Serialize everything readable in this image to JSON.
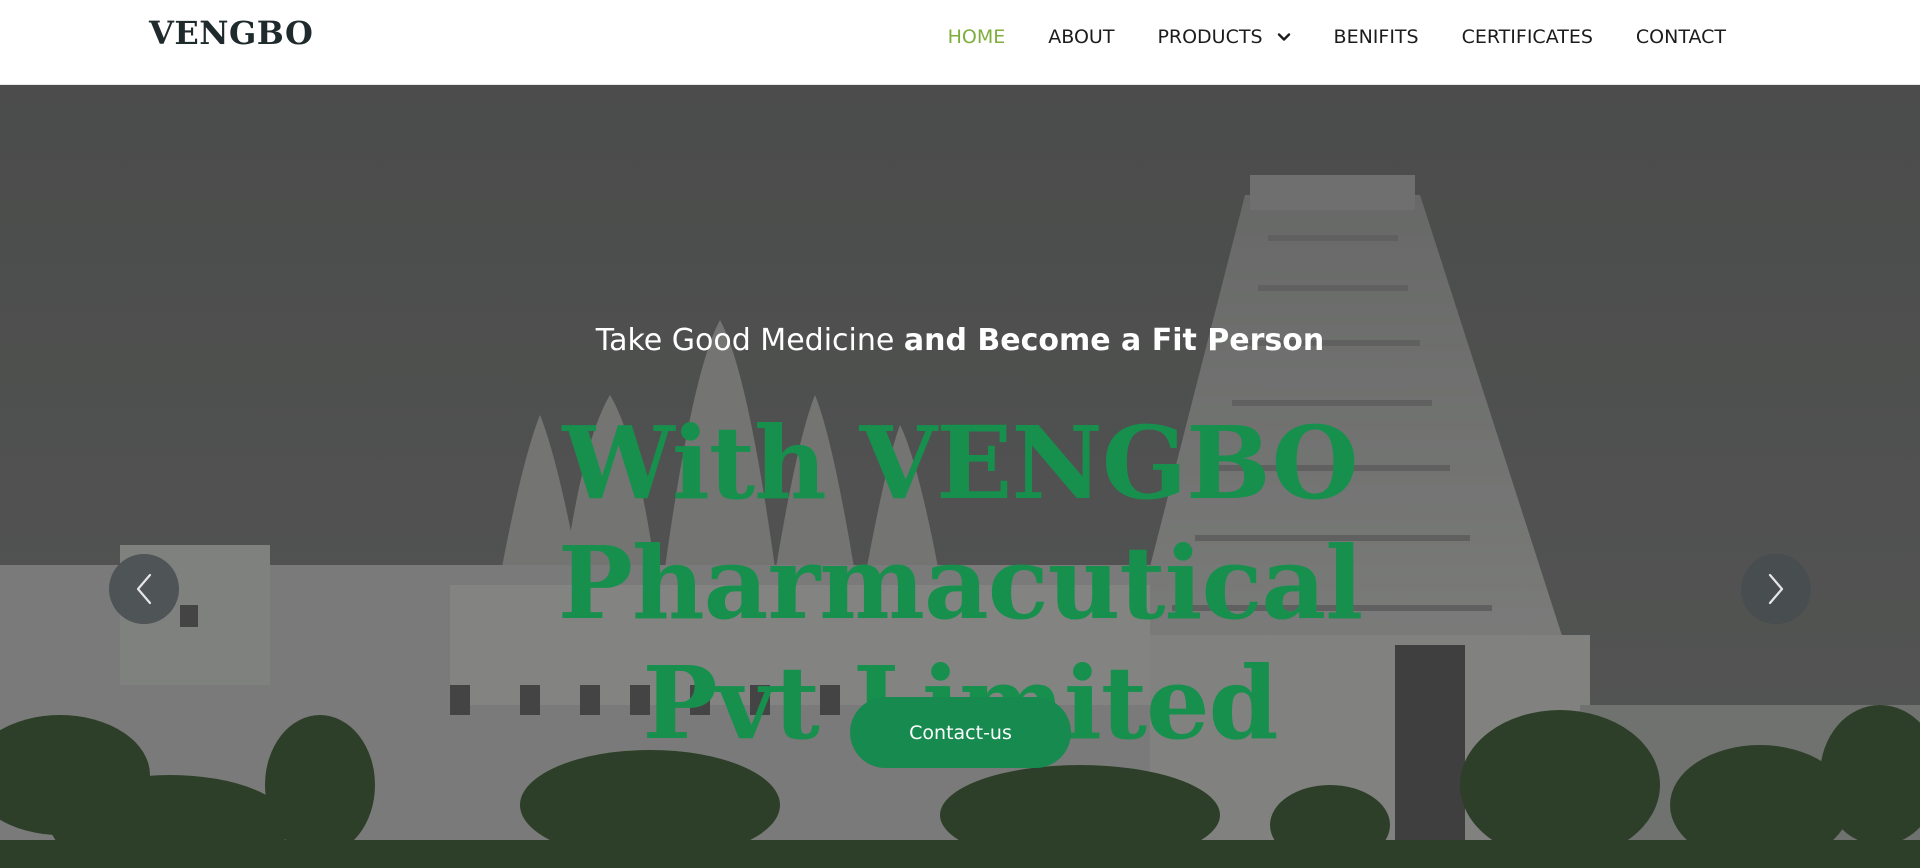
{
  "header": {
    "logo": "VENGBO",
    "nav": [
      {
        "label": "HOME",
        "active": true
      },
      {
        "label": "ABOUT",
        "active": false
      },
      {
        "label": "PRODUCTS",
        "active": false,
        "has_dropdown": true
      },
      {
        "label": "BENIFITS",
        "active": false
      },
      {
        "label": "CERTIFICATES",
        "active": false
      },
      {
        "label": "CONTACT",
        "active": false
      }
    ],
    "active_color": "#7fae3c",
    "icons": {
      "products_dropdown": "chevron-down-icon"
    }
  },
  "hero": {
    "tagline_light": "Take Good Medicine ",
    "tagline_bold": "and Become a Fit Person",
    "headline": "With VENGBO Pharmacutical Pvt Limited",
    "headline_color": "#17904e",
    "cta_label": "Contact-us",
    "cta_color": "#178a50",
    "prev_icon": "chevron-left-icon",
    "next_icon": "chevron-right-icon"
  }
}
